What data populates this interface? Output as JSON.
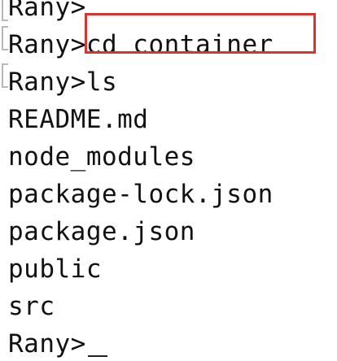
{
  "terminal": {
    "lines": [
      "Rany>",
      "Rany>cd container",
      "Rany>ls",
      "README.md",
      "node_modules",
      "package-lock.json",
      "package.json",
      "public",
      "src",
      "Rany>"
    ],
    "highlight_color": "#e0322d"
  }
}
